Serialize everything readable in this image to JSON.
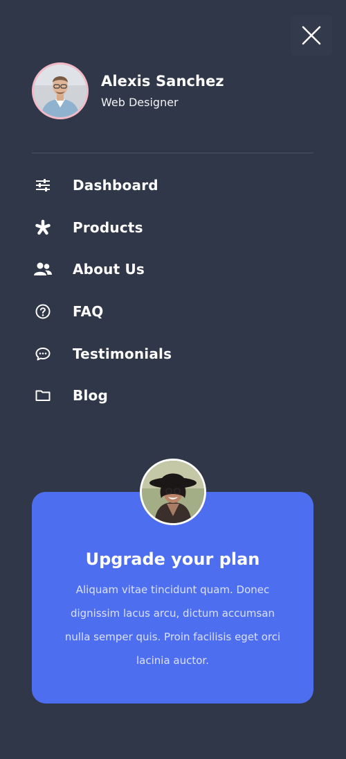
{
  "header": {
    "close_icon": "close-icon"
  },
  "profile": {
    "name": "Alexis Sanchez",
    "role": "Web Designer",
    "avatar_icon": "user-avatar"
  },
  "nav": {
    "items": [
      {
        "label": "Dashboard",
        "icon": "sliders-icon"
      },
      {
        "label": "Products",
        "icon": "star-icon"
      },
      {
        "label": "About Us",
        "icon": "users-icon"
      },
      {
        "label": "FAQ",
        "icon": "question-icon"
      },
      {
        "label": "Testimonials",
        "icon": "chat-icon"
      },
      {
        "label": "Blog",
        "icon": "folder-icon"
      }
    ]
  },
  "upgrade": {
    "title": "Upgrade your plan",
    "description": "Aliquam vitae tincidunt quam. Donec dignissim lacus arcu, dictum accumsan nulla semper quis. Proin facilisis eget orci lacinia auctor."
  },
  "colors": {
    "background": "#303748",
    "accent": "#4e6ef0",
    "avatar_ring": "#f2b9c7"
  }
}
